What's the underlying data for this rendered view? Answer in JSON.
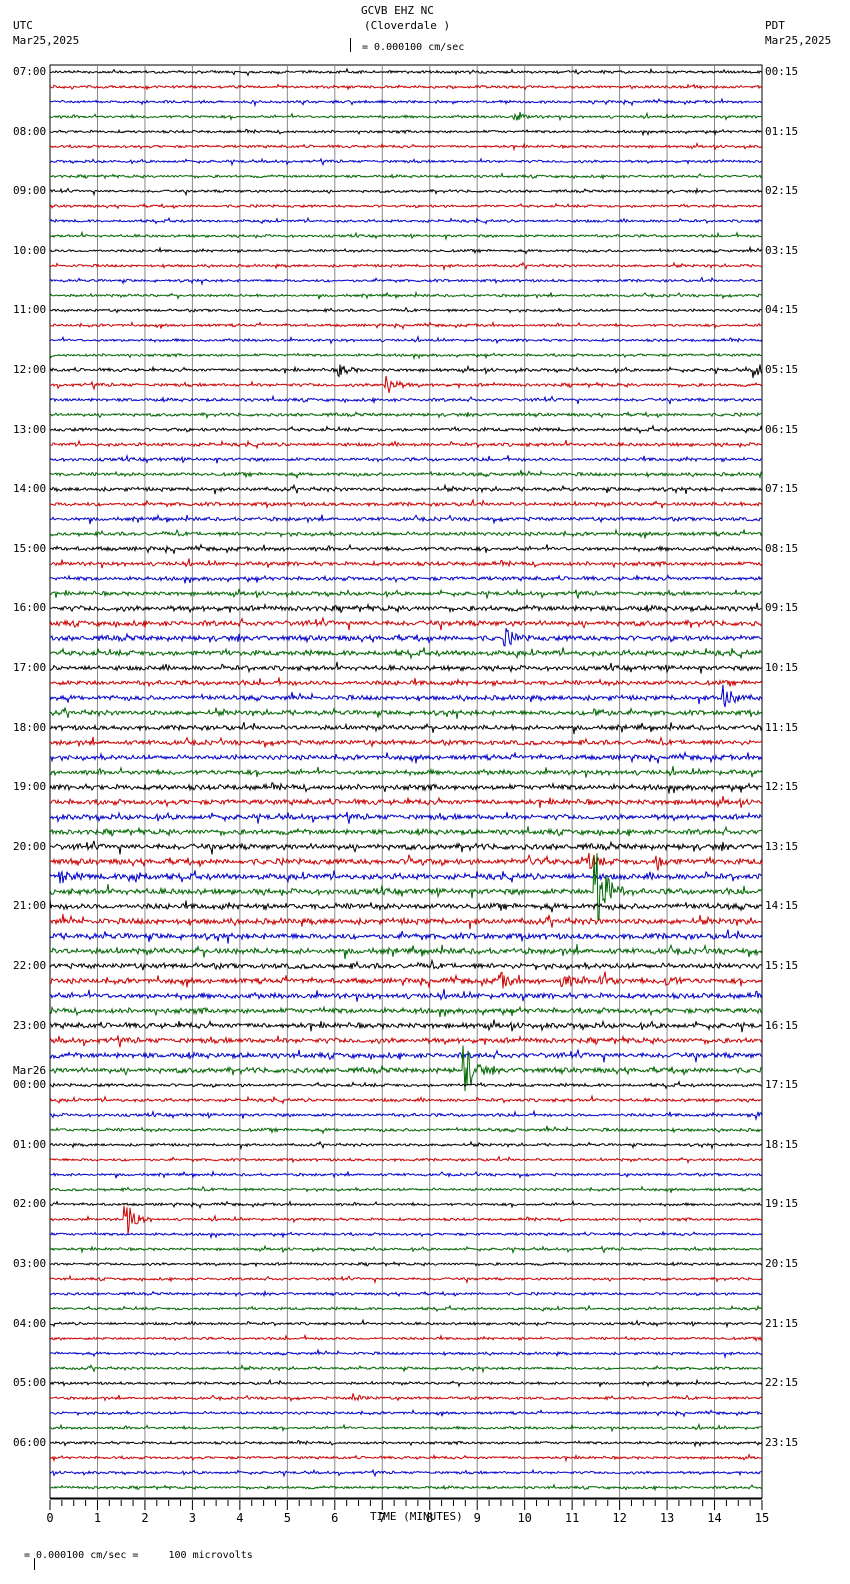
{
  "header": {
    "station": "GCVB EHZ NC",
    "location": "(Cloverdale )",
    "scale": "= 0.000100 cm/sec",
    "left_tz": "UTC",
    "left_date": "Mar25,2025",
    "right_tz": "PDT",
    "right_date": "Mar25,2025"
  },
  "footer": {
    "scale_text": "= 0.000100 cm/sec =     100 microvolts"
  },
  "chart_data": {
    "type": "line",
    "title": "GCVB EHZ NC (Cloverdale )",
    "xlabel": "TIME (MINUTES)",
    "xlim": [
      0,
      15
    ],
    "x_ticks": [
      "0",
      "1",
      "2",
      "3",
      "4",
      "5",
      "6",
      "7",
      "8",
      "9",
      "10",
      "11",
      "12",
      "13",
      "14",
      "15"
    ],
    "trace_colors": [
      "#000000",
      "#cc0000",
      "#0000cc",
      "#006600"
    ],
    "traces_per_hour": 4,
    "left_labels": [
      "07:00",
      "08:00",
      "09:00",
      "10:00",
      "11:00",
      "12:00",
      "13:00",
      "14:00",
      "15:00",
      "16:00",
      "17:00",
      "18:00",
      "19:00",
      "20:00",
      "21:00",
      "22:00",
      "23:00",
      "00:00",
      "01:00",
      "02:00",
      "03:00",
      "04:00",
      "05:00",
      "06:00"
    ],
    "date_change_label": "Mar26",
    "right_labels": [
      "00:15",
      "01:15",
      "02:15",
      "03:15",
      "04:15",
      "05:15",
      "06:15",
      "07:15",
      "08:15",
      "09:15",
      "10:15",
      "11:15",
      "12:15",
      "13:15",
      "14:15",
      "15:15",
      "16:15",
      "17:15",
      "18:15",
      "19:15",
      "20:15",
      "21:15",
      "22:15",
      "23:15"
    ],
    "noise_levels_by_hour": [
      1,
      1,
      1,
      1,
      1,
      1.2,
      1.3,
      1.4,
      1.5,
      2,
      1.8,
      1.8,
      2,
      2.2,
      2.2,
      2,
      2,
      1.2,
      1,
      1,
      1,
      1,
      1,
      1
    ],
    "events": [
      {
        "trace": 3,
        "minute": 9.8,
        "amp": 4
      },
      {
        "trace": 20,
        "minute": 6.1,
        "amp": 6
      },
      {
        "trace": 20,
        "minute": 14.85,
        "amp": 8
      },
      {
        "trace": 21,
        "minute": 7.1,
        "amp": 10
      },
      {
        "trace": 38,
        "minute": 9.6,
        "amp": 8
      },
      {
        "trace": 42,
        "minute": 14.2,
        "amp": 14
      },
      {
        "trace": 43,
        "minute": 11.5,
        "amp": 5
      },
      {
        "trace": 53,
        "minute": 7.6,
        "amp": 5
      },
      {
        "trace": 53,
        "minute": 10.1,
        "amp": 6
      },
      {
        "trace": 53,
        "minute": 11.3,
        "amp": 10
      },
      {
        "trace": 53,
        "minute": 12.8,
        "amp": 7
      },
      {
        "trace": 54,
        "minute": 0.2,
        "amp": 8
      },
      {
        "trace": 54,
        "minute": 1.7,
        "amp": 10
      },
      {
        "trace": 55,
        "minute": 11.5,
        "amp": 60
      },
      {
        "trace": 61,
        "minute": 9.5,
        "amp": 7
      },
      {
        "trace": 61,
        "minute": 10.8,
        "amp": 7
      },
      {
        "trace": 61,
        "minute": 11.6,
        "amp": 9
      },
      {
        "trace": 61,
        "minute": 13.0,
        "amp": 6
      },
      {
        "trace": 67,
        "minute": 8.75,
        "amp": 26
      },
      {
        "trace": 77,
        "minute": 1.6,
        "amp": 20
      },
      {
        "trace": 89,
        "minute": 6.4,
        "amp": 4
      },
      {
        "trace": 70,
        "minute": 14.9,
        "amp": 4
      }
    ]
  }
}
